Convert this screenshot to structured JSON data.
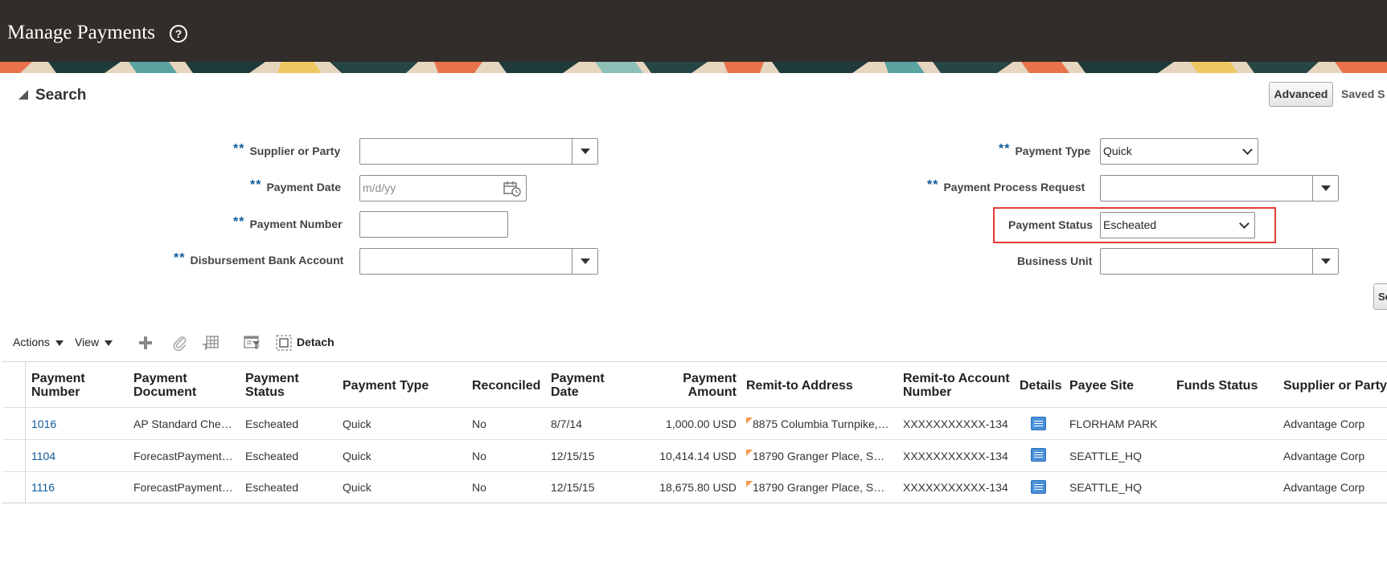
{
  "header": {
    "title": "Manage Payments",
    "help_icon_glyph": "?"
  },
  "search": {
    "title": "Search",
    "advanced_label": "Advanced",
    "saved_search_label": "Saved S",
    "search_button_label": "Se",
    "required_marker": "**",
    "fields": {
      "supplier_or_party": {
        "label": "Supplier or Party",
        "value": ""
      },
      "payment_date": {
        "label": "Payment Date",
        "value": "",
        "placeholder": "m/d/yy"
      },
      "payment_number": {
        "label": "Payment Number",
        "value": ""
      },
      "disbursement_bank_account": {
        "label": "Disbursement Bank Account",
        "value": ""
      },
      "payment_type": {
        "label": "Payment Type",
        "value": "Quick"
      },
      "payment_process_request": {
        "label": "Payment Process Request",
        "value": ""
      },
      "payment_status": {
        "label": "Payment Status",
        "value": "Escheated"
      },
      "business_unit": {
        "label": "Business Unit",
        "value": ""
      }
    },
    "highlight_color": "#e53935"
  },
  "toolbar": {
    "actions_label": "Actions",
    "view_label": "View",
    "detach_label": "Detach",
    "icons": [
      "add-icon",
      "attach-icon",
      "freeze-columns-icon",
      "query-by-example-icon",
      "detach-icon"
    ]
  },
  "table": {
    "columns": [
      "Payment Number",
      "Payment Document",
      "Payment Status",
      "Payment Type",
      "Reconciled",
      "Payment Date",
      "Payment Amount",
      "Remit-to Address",
      "Remit-to Account Number",
      "Details",
      "Payee Site",
      "Funds Status",
      "Supplier or Party"
    ],
    "column_lines": {
      "payment_number": [
        "Payment",
        "Number"
      ],
      "payment_document": [
        "Payment",
        "Document"
      ],
      "payment_status": [
        "Payment",
        "Status"
      ],
      "payment_date": [
        "Payment",
        "Date"
      ],
      "payment_amount": [
        "Payment",
        "Amount"
      ],
      "remit_to_account_number": [
        "Remit-to Account",
        "Number"
      ]
    },
    "rows": [
      {
        "payment_number": "1016",
        "payment_document": "AP Standard Che…",
        "payment_status": "Escheated",
        "payment_type": "Quick",
        "reconciled": "No",
        "payment_date": "8/7/14",
        "payment_amount": "1,000.00 USD",
        "remit_to_address": "8875 Columbia Turnpike,…",
        "remit_to_account_number": "XXXXXXXXXXX-134",
        "details_icon": "details-icon",
        "payee_site": "FLORHAM PARK",
        "funds_status": "",
        "supplier_or_party": "Advantage Corp"
      },
      {
        "payment_number": "1104",
        "payment_document": "ForecastPayment…",
        "payment_status": "Escheated",
        "payment_type": "Quick",
        "reconciled": "No",
        "payment_date": "12/15/15",
        "payment_amount": "10,414.14 USD",
        "remit_to_address": "18790 Granger Place, S…",
        "remit_to_account_number": "XXXXXXXXXXX-134",
        "details_icon": "details-icon",
        "payee_site": "SEATTLE_HQ",
        "funds_status": "",
        "supplier_or_party": "Advantage Corp"
      },
      {
        "payment_number": "1116",
        "payment_document": "ForecastPayment…",
        "payment_status": "Escheated",
        "payment_type": "Quick",
        "reconciled": "No",
        "payment_date": "12/15/15",
        "payment_amount": "18,675.80 USD",
        "remit_to_address": "18790 Granger Place, S…",
        "remit_to_account_number": "XXXXXXXXXXX-134",
        "details_icon": "details-icon",
        "payee_site": "SEATTLE_HQ",
        "funds_status": "",
        "supplier_or_party": "Advantage Corp"
      }
    ]
  }
}
